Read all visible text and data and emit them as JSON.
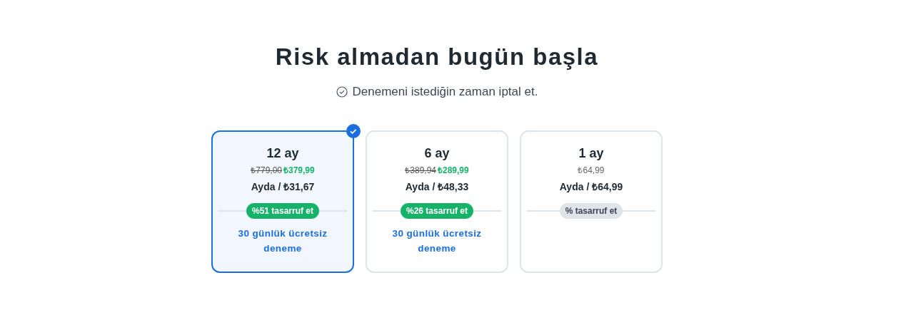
{
  "title": "Risk almadan bugün başla",
  "subtitle": "Denemeni istediğin zaman iptal et.",
  "plans": [
    {
      "name": "12 ay",
      "selected": true,
      "old_price": "₺779,00",
      "price": "₺379,99",
      "monthly": "Ayda / ₺31,67",
      "badge": {
        "text": "%51 tasarruf et",
        "highlight": true
      },
      "trial": "30 günlük ücretsiz deneme"
    },
    {
      "name": "6 ay",
      "selected": false,
      "old_price": "₺389,94",
      "price": "₺289,99",
      "monthly": "Ayda / ₺48,33",
      "badge": {
        "text": "%26 tasarruf et",
        "highlight": true
      },
      "trial": "30 günlük ücretsiz deneme"
    },
    {
      "name": "1 ay",
      "selected": false,
      "price": "₺64,99",
      "monthly": "Ayda / ₺64,99",
      "badge": {
        "text": "% tasarruf et",
        "highlight": false
      }
    }
  ]
}
